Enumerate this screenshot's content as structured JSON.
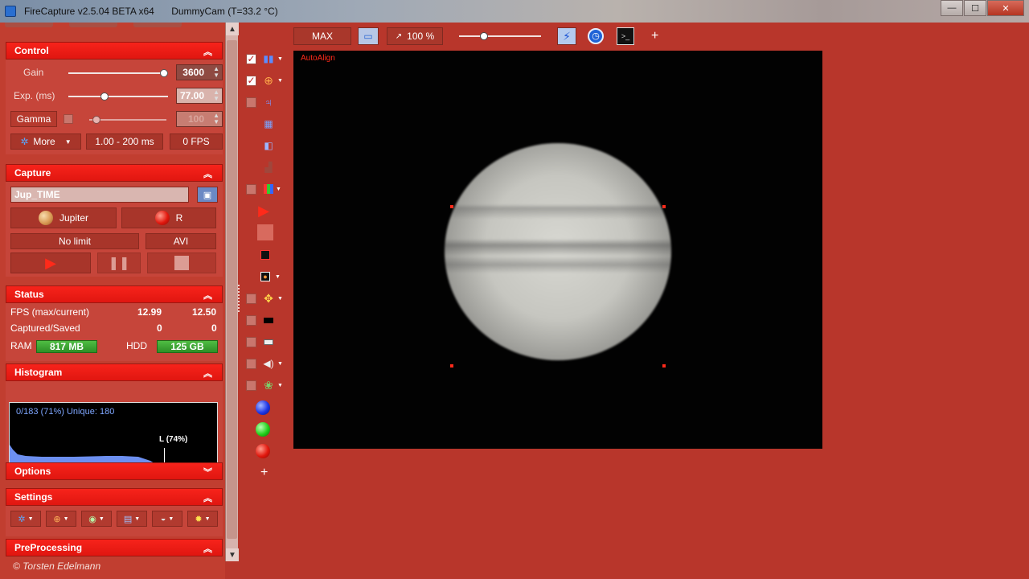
{
  "window": {
    "title_app": "FireCapture v2.5.04 BETA x64",
    "title_camera": "DummyCam (T=33.2 °C)",
    "buttons": {
      "minimize": "—",
      "maximize": "☐",
      "close": "✕"
    }
  },
  "control": {
    "header": "Control",
    "gain_label": "Gain",
    "gain_value": "3600",
    "exp_label": "Exp. (ms)",
    "exp_value": "77.00",
    "gamma_label": "Gamma",
    "gamma_value": "100",
    "more_label": "More",
    "range_label": "1.00 - 200 ms",
    "fps_label": "0 FPS"
  },
  "capture": {
    "header": "Capture",
    "filename": "Jup_TIME",
    "object_label": "Jupiter",
    "filter_label": "R",
    "limit_label": "No limit",
    "format_label": "AVI"
  },
  "status": {
    "header": "Status",
    "fps_label": "FPS (max/current)",
    "fps_max": "12.99",
    "fps_current": "12.50",
    "captured_label": "Captured/Saved",
    "captured": "0",
    "saved": "0",
    "ram_label": "RAM",
    "ram_value": "817 MB",
    "hdd_label": "HDD",
    "hdd_value": "125 GB"
  },
  "histogram": {
    "header": "Histogram",
    "info": "0/183 (71%)   Unique: 180",
    "marker_label": "L (74%)"
  },
  "options": {
    "header": "Options"
  },
  "settings": {
    "header": "Settings"
  },
  "preprocessing": {
    "header": "PreProcessing"
  },
  "footer": "© Torsten Edelmann",
  "toolbar": {
    "max_label": "MAX",
    "zoom_label": "100 %",
    "add_label": "+"
  },
  "viewer": {
    "autoalign_label": "AutoAlign"
  },
  "side_tools": {
    "add_label": "+"
  },
  "colors": {
    "background": "#b8362b",
    "header_red": "#f7231b",
    "ram_green": "#3fa935",
    "autoalign_red": "#ff2a1a"
  }
}
